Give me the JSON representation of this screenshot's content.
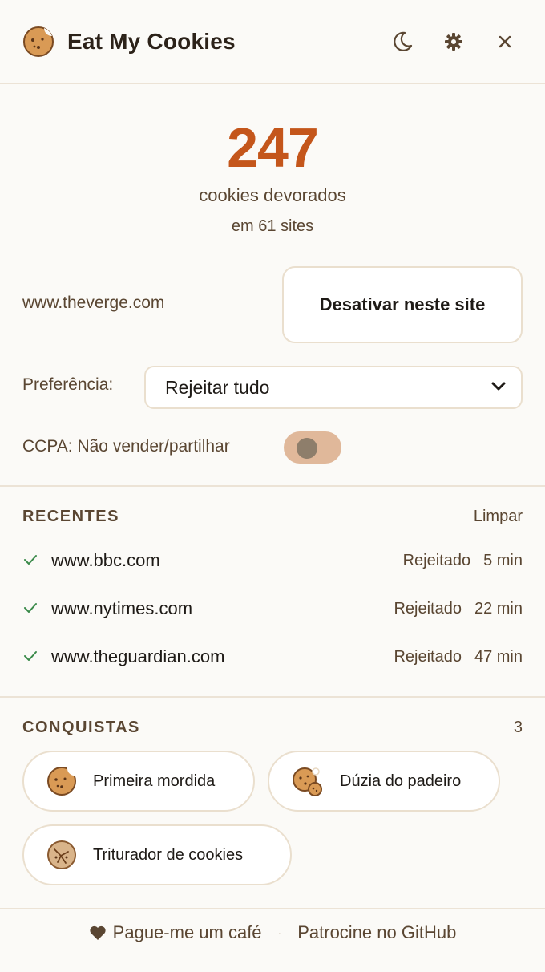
{
  "app": {
    "title": "Eat My Cookies"
  },
  "header": {
    "icons": [
      "moon-icon",
      "gear-icon",
      "close-icon"
    ]
  },
  "stats": {
    "count": "247",
    "label": "cookies devorados",
    "sub": "em 61 sites"
  },
  "site": {
    "domain": "www.theverge.com",
    "disable_label": "Desativar neste site"
  },
  "preference": {
    "label": "Preferência:",
    "selected": "Rejeitar tudo"
  },
  "ccpa": {
    "label": "CCPA: Não vender/partilhar",
    "enabled": false
  },
  "recents": {
    "title": "RECENTES",
    "clear_label": "Limpar",
    "items": [
      {
        "site": "www.bbc.com",
        "status": "Rejeitado",
        "time": "5 min"
      },
      {
        "site": "www.nytimes.com",
        "status": "Rejeitado",
        "time": "22 min"
      },
      {
        "site": "www.theguardian.com",
        "status": "Rejeitado",
        "time": "47 min"
      }
    ]
  },
  "achievements": {
    "title": "CONQUISTAS",
    "count": "3",
    "items": [
      {
        "label": "Primeira mordida",
        "icon": "cookie-bitten-icon"
      },
      {
        "label": "Dúzia do padeiro",
        "icon": "cookie-stack-icon"
      },
      {
        "label": "Triturador de cookies",
        "icon": "cookie-crushed-icon"
      }
    ]
  },
  "footer": {
    "coffee_label": "Pague-me um café",
    "separator": "·",
    "github_label": "Patrocine no GitHub"
  },
  "colors": {
    "accent": "#c4561b",
    "toggle_off": "#e0b89a",
    "check": "#3a8a4a",
    "background": "#fbfaf7"
  }
}
